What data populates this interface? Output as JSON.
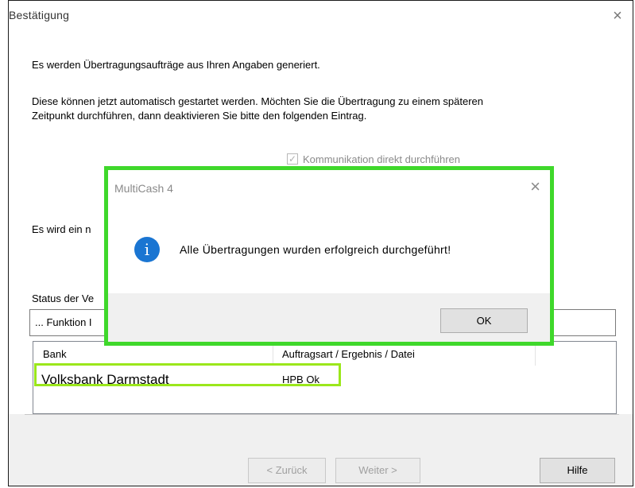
{
  "window": {
    "title": "Bestätigung",
    "close_glyph": "×"
  },
  "content": {
    "line1": "Es werden Übertragungsaufträge aus Ihren Angaben generiert.",
    "line2": "Diese können jetzt automatisch gestartet werden. Möchten Sie die Übertragung zu einem späteren",
    "line3": "Zeitpunkt durchführen, dann deaktivieren Sie bitte den folgenden Eintrag.",
    "checkbox_label": "Kommunikation direkt durchführen",
    "checkbox_checked": true,
    "partial_text": "Es wird ein n",
    "status_label": "Status der Ve",
    "status_value": "... Funktion I"
  },
  "table": {
    "headers": [
      "Bank",
      "Auftragsart / Ergebnis / Datei"
    ],
    "rows": [
      {
        "bank": "Volksbank Darmstadt",
        "result": "HPB Ok"
      }
    ]
  },
  "buttons": {
    "back": "< Zurück",
    "next": "Weiter >",
    "help": "Hilfe"
  },
  "dialog": {
    "title": "MultiCash 4",
    "close_glyph": "×",
    "icon": "info-icon",
    "icon_glyph": "i",
    "message": "Alle Übertragungen wurden erfolgreich durchgeführt!",
    "ok": "OK"
  },
  "colors": {
    "highlight_dialog": "#3fd82b",
    "highlight_row": "#9be71b",
    "info_icon": "#1a75d2"
  }
}
